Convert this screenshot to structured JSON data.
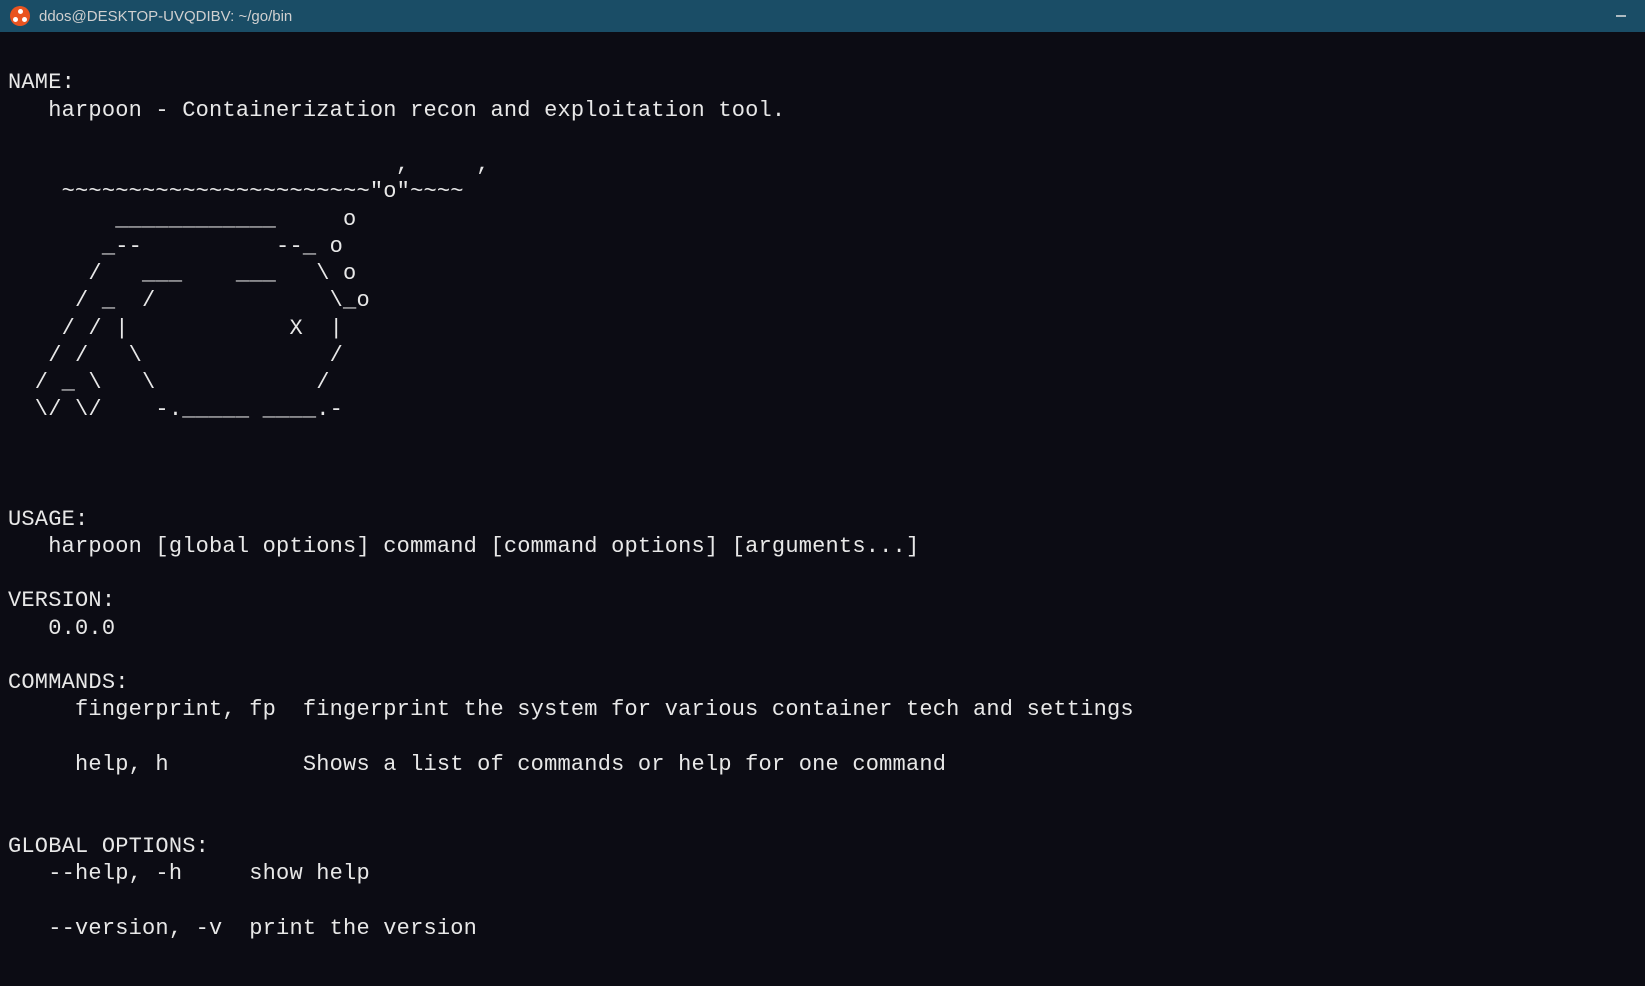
{
  "window": {
    "title": "ddos@DESKTOP-UVQDIBV: ~/go/bin"
  },
  "terminal": {
    "name_heading": "NAME:",
    "name_value": "   harpoon - Containerization recon and exploitation tool.",
    "ascii_art": "                         ,     ,\n    ~~~~~~~~~~~~~~~~~~~~~~~\"o\"~~~~\n        ____________     o\n       _--          --_ o\n      /   ___    ___   \\ o\n     / _  /             \\_o\n    / / |            X  |\n   / /   \\              /\n  / _ \\   \\            /\n  \\/ \\/    -._____ ____.-",
    "usage_heading": "USAGE:",
    "usage_value": "   harpoon [global options] command [command options] [arguments...]",
    "version_heading": "VERSION:",
    "version_value": "   0.0.0",
    "commands_heading": "COMMANDS:",
    "commands_row1": "     fingerprint, fp  fingerprint the system for various container tech and settings",
    "commands_row2": "     help, h          Shows a list of commands or help for one command",
    "global_heading": "GLOBAL OPTIONS:",
    "global_row1": "   --help, -h     show help",
    "global_row2": "   --version, -v  print the version"
  }
}
